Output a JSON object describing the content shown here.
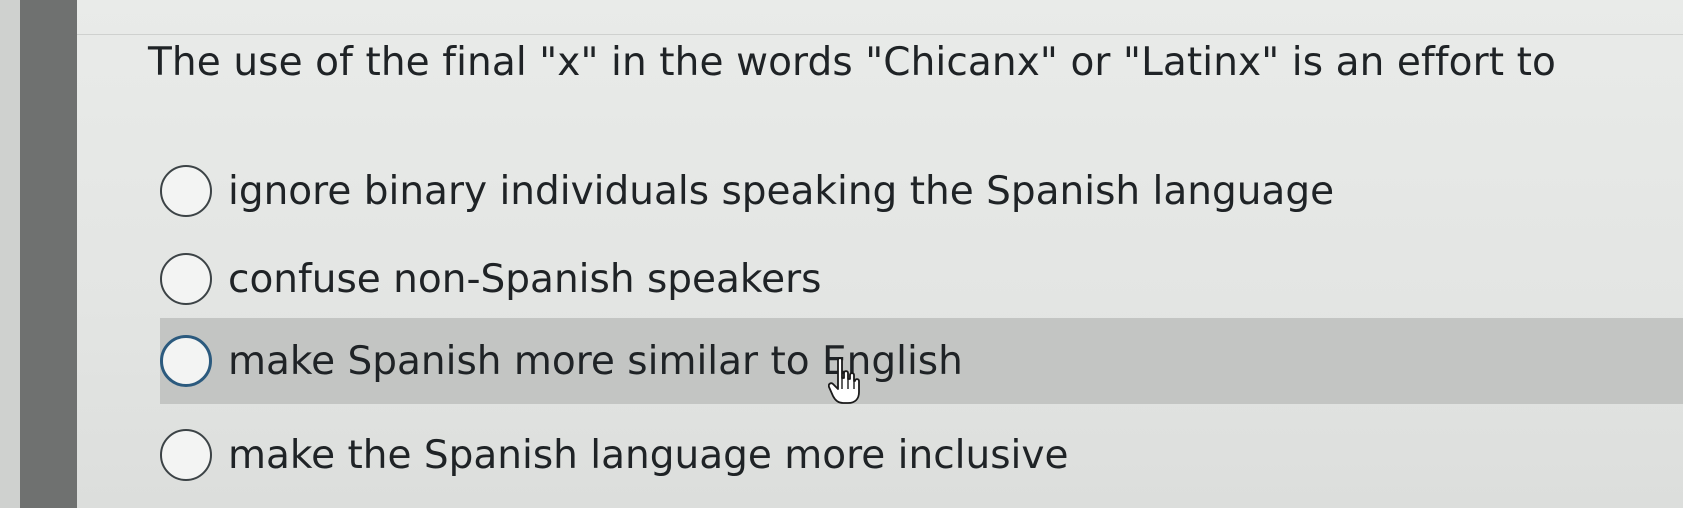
{
  "question": {
    "text": "The use of the final \"x\" in the words \"Chicanx\" or \"Latinx\" is an effort to"
  },
  "answers": [
    {
      "label": "ignore binary individuals speaking the Spanish language",
      "selected": false,
      "hovered": false
    },
    {
      "label": "confuse non-Spanish speakers",
      "selected": false,
      "hovered": false
    },
    {
      "label": "make Spanish more similar to English",
      "selected": false,
      "hovered": true
    },
    {
      "label": "make the Spanish language more inclusive",
      "selected": false,
      "hovered": false
    }
  ],
  "cursor": {
    "icon": "hand-pointer-icon"
  },
  "colors": {
    "background": "#e4e6e4",
    "sidebar": "#6f7170",
    "hover_row": "#c3c5c3",
    "text": "#1f2326",
    "radio_hover_border": "#2b5a7e"
  }
}
